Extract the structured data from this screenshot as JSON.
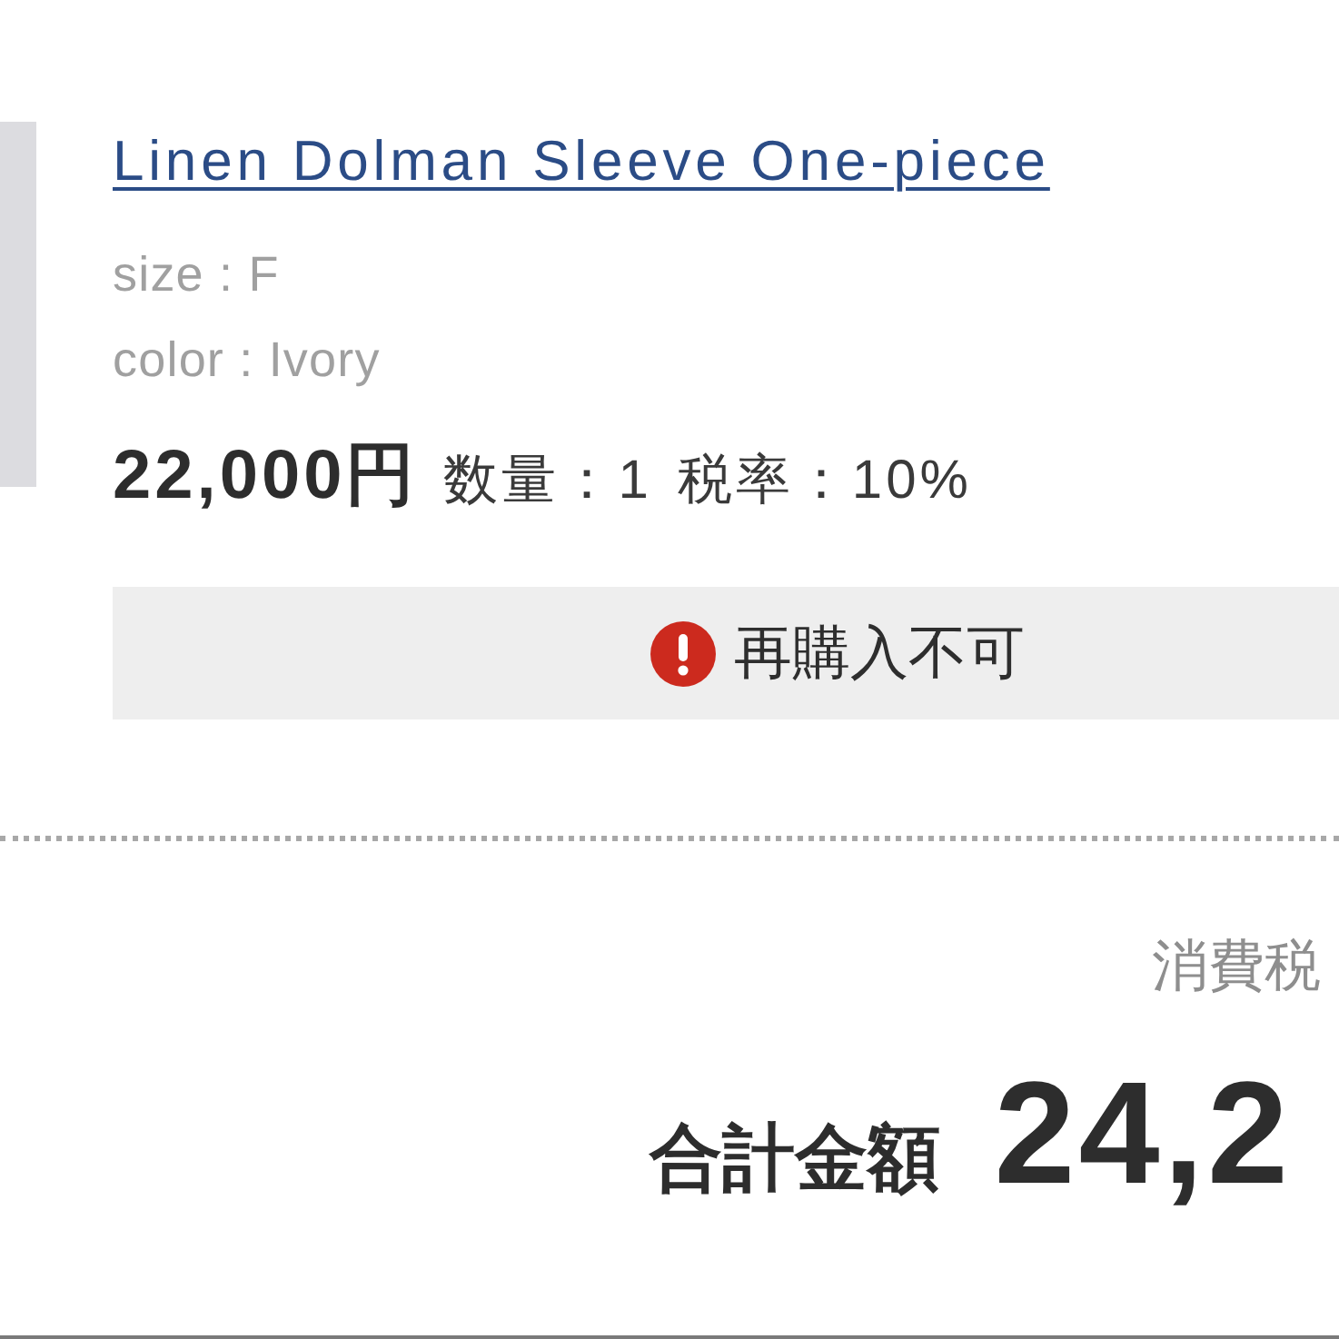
{
  "product": {
    "title": "Linen Dolman Sleeve One-piece",
    "options": [
      "size : F",
      "color : Ivory"
    ],
    "price": "22,000円",
    "quantity": "数量：1",
    "tax_rate": "税率：10%"
  },
  "notice": {
    "text": "再購入不可"
  },
  "summary": {
    "tax_label": "消費税",
    "total_label": "合計金額",
    "total_value": "24,2"
  }
}
